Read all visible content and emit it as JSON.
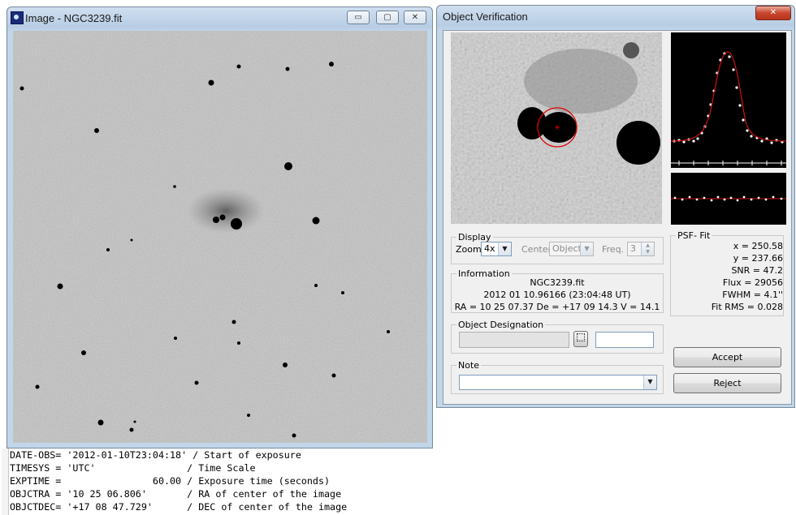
{
  "image_window": {
    "title": "Image - NGC3239.fit",
    "controls": {
      "minimize": "▭",
      "maximize": "▢",
      "close": "✕"
    }
  },
  "verification_window": {
    "title": "Object Verification",
    "close": "✕",
    "display": {
      "legend": "Display",
      "zoom_label": "Zoom",
      "zoom_value": "4x",
      "center_label": "Center",
      "center_value": "Object",
      "freq_label": "Freq.",
      "freq_value": "3"
    },
    "information": {
      "legend": "Information",
      "filename": "NGC3239.fit",
      "date": "2012 01 10.96166 (23:04:48 UT)",
      "coords": "RA = 10 25 07.37   De = +17 09 14.3   V = 14.1"
    },
    "designation": {
      "legend": "Object Designation"
    },
    "note": {
      "legend": "Note"
    },
    "psf_fit": {
      "legend": "PSF- Fit",
      "x": "x = 250.58",
      "y": "y = 237.66",
      "snr": "SNR = 47.2",
      "flux": "Flux = 29056",
      "fwhm": "FWHM = 4.1''",
      "fit_rms": "Fit RMS = 0.028"
    },
    "accept_label": "Accept",
    "reject_label": "Reject"
  },
  "fits_header": [
    "DATE-OBS= '2012-01-10T23:04:18' / Start of exposure",
    "TIMESYS = 'UTC'                / Time Scale",
    "EXPTIME =                60.00 / Exposure time (seconds)",
    "OBJCTRA = '10 25 06.806'       / RA of center of the image",
    "OBJCTDEC= '+17 08 47.729'      / DEC of center of the image"
  ],
  "colors": {
    "aperture": "#e00000",
    "psf_curve": "#d01010",
    "stars": "#000000"
  }
}
